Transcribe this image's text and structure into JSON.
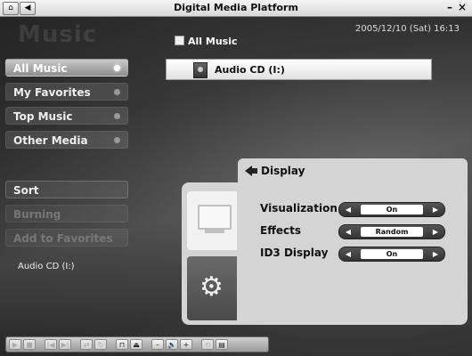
{
  "window": {
    "title": "Digital Media Platform",
    "minimize": "–",
    "close": "×"
  },
  "toolbar_top": {
    "home_icon": "home-icon",
    "back_icon": "back-arrow-icon"
  },
  "header": {
    "watermark": "Music",
    "datetime": "2005/12/10 (Sat)  16:13",
    "list_title": "All Music"
  },
  "sidebar": {
    "items": [
      {
        "label": "All Music",
        "active": true
      },
      {
        "label": "My Favorites",
        "active": false
      },
      {
        "label": "Top Music",
        "active": false
      },
      {
        "label": "Other Media",
        "active": false
      }
    ],
    "actions": [
      {
        "label": "Sort",
        "enabled": true
      },
      {
        "label": "Burning",
        "enabled": false
      },
      {
        "label": "Add to Favorites",
        "enabled": false
      }
    ],
    "source": "Audio CD  (I:)"
  },
  "list": {
    "items": [
      {
        "label": "Audio CD  (I:)",
        "icon": "cd-drive-icon"
      }
    ]
  },
  "display_panel": {
    "title": "Display",
    "settings": [
      {
        "label": "Visualization",
        "value": "On"
      },
      {
        "label": "Effects",
        "value": "Random"
      },
      {
        "label": "ID3 Display",
        "value": "On"
      }
    ]
  },
  "bottom_toolbar": {
    "buttons": [
      "▶",
      "■",
      "|◀",
      "▶|",
      "⇄",
      "↻",
      "⊓",
      "⏏",
      "–",
      "🔈",
      "+",
      "⟲",
      "▤"
    ]
  }
}
